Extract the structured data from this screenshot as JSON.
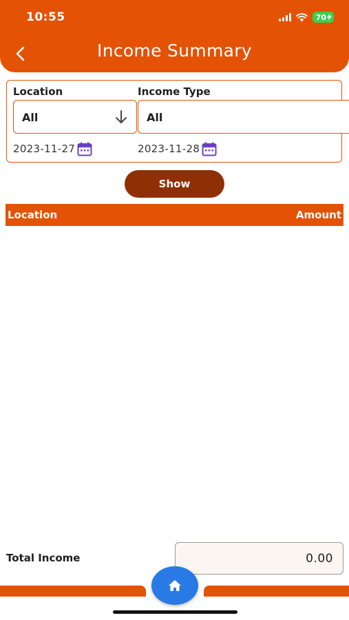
{
  "status_bar": {
    "time": "10:55",
    "battery": "70"
  },
  "header": {
    "title": "Income Summary",
    "back_icon": "chevron-left-icon"
  },
  "filters": {
    "location_label": "Location",
    "location_value": "All",
    "income_type_label": "Income Type",
    "income_type_value": "All",
    "start_date": "2023-11-27",
    "end_date": "2023-11-28"
  },
  "show_button_label": "Show",
  "table": {
    "columns": [
      "Location",
      "Amount"
    ],
    "rows": []
  },
  "total": {
    "label": "Total Income",
    "value": "0.00"
  },
  "nav": {
    "home_icon": "home-icon"
  },
  "colors": {
    "primary": "#e35205",
    "button": "#8f2f05",
    "fab": "#2a7ae6",
    "calendar": "#6a3fc4"
  }
}
